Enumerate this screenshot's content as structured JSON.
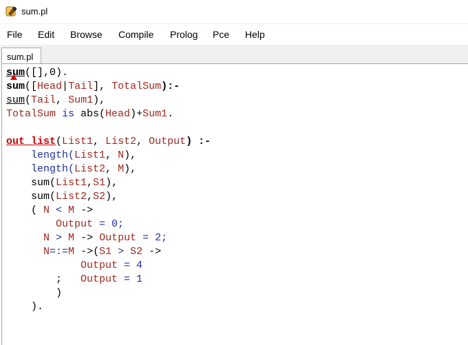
{
  "window": {
    "title": "sum.pl",
    "icon": "swi-prolog-icon"
  },
  "menu": [
    "File",
    "Edit",
    "Browse",
    "Compile",
    "Prolog",
    "Pce",
    "Help"
  ],
  "tabs": [
    {
      "label": "sum.pl"
    }
  ],
  "code": {
    "l1": {
      "a": "sum",
      "b": "([],0)."
    },
    "l2": {
      "a": "sum",
      "b": "([",
      "c": "Head",
      "d": "|",
      "e": "Tail",
      "f": "], ",
      "g": "TotalSum",
      "h": "):-"
    },
    "l3": {
      "a": "sum",
      "b": "(",
      "c": "Tail",
      "d": ", ",
      "e": "Sum1",
      "f": "),"
    },
    "l4": {
      "a": "TotalSum",
      "b": " is ",
      "c": "abs(",
      "d": "Head",
      "e": ")+",
      "f": "Sum1",
      "g": "."
    },
    "l6": {
      "a": "out_list",
      "b": "(",
      "c": "List1",
      "d": ", ",
      "e": "List2",
      "f": ", ",
      "g": "Output",
      "h": ") :-"
    },
    "l7": {
      "a": "    length(",
      "b": "List1",
      "c": ", ",
      "d": "N",
      "e": "),"
    },
    "l8": {
      "a": "    length(",
      "b": "List2",
      "c": ", ",
      "d": "M",
      "e": "),"
    },
    "l9": {
      "a": "    sum(",
      "b": "List1",
      "c": ",",
      "d": "S1",
      "e": "),"
    },
    "l10": {
      "a": "    sum(",
      "b": "List2",
      "c": ",",
      "d": "S2",
      "e": "),"
    },
    "l11": {
      "a": "    ( ",
      "b": "N",
      "c": " < ",
      "d": "M",
      "e": " ->"
    },
    "l12": {
      "a": "        ",
      "b": "Output",
      "c": " = 0;"
    },
    "l13": {
      "a": "      ",
      "b": "N",
      "c": " > ",
      "d": "M",
      "e": " -> ",
      "f": "Output",
      "g": " = 2;"
    },
    "l14": {
      "a": "      ",
      "b": "N",
      "c": "=:=",
      "d": "M",
      "e": " ->(",
      "f": "S1",
      "g": " > ",
      "h": "S2",
      "i": " ->"
    },
    "l15": {
      "a": "            ",
      "b": "Output",
      "c": " = 4"
    },
    "l16": {
      "a": "        ;   ",
      "b": "Output",
      "c": " = 1"
    },
    "l17": {
      "a": "        )"
    },
    "l18": {
      "a": "    )."
    }
  }
}
